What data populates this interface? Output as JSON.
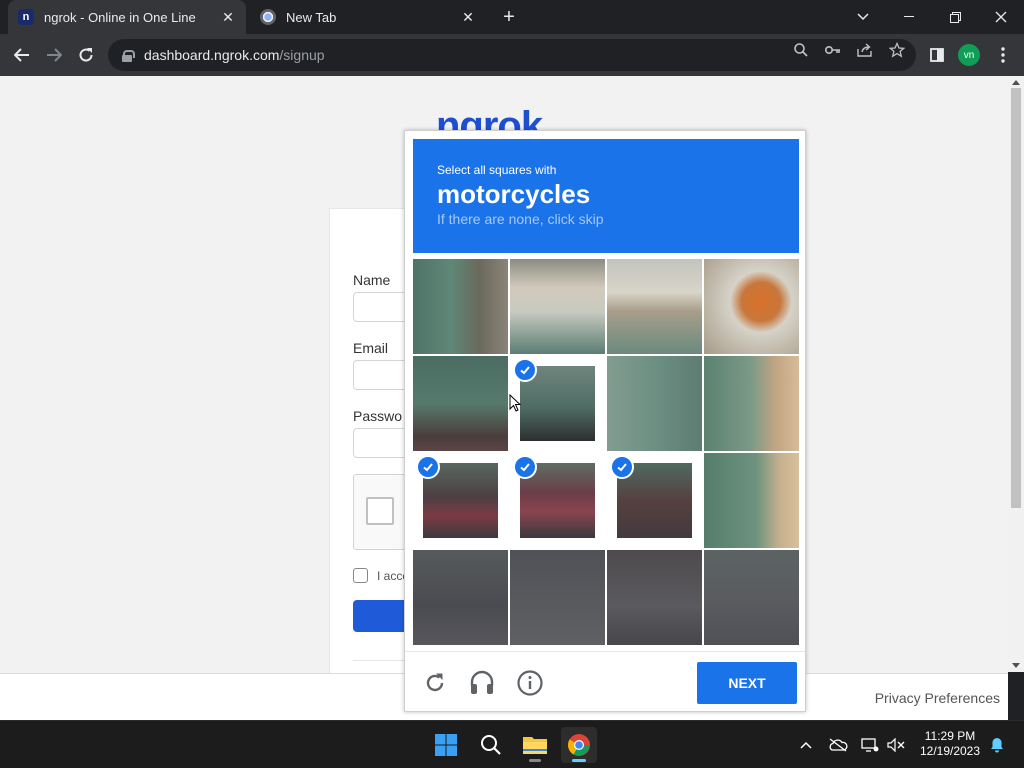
{
  "browser": {
    "tabs": [
      {
        "title": "ngrok - Online in One Line",
        "favicon": "ngrok-favicon",
        "active": true
      },
      {
        "title": "New Tab",
        "favicon": "chrome-favicon",
        "active": false
      }
    ],
    "new_tab_symbol": "+",
    "tab_close_symbol": "✕",
    "url_host": "dashboard.ngrok.com",
    "url_path": "/signup",
    "profile_initials": "vn"
  },
  "page": {
    "logo_text": "ngrok",
    "fields": [
      {
        "label": "Name",
        "value": ""
      },
      {
        "label": "Email",
        "value": ""
      },
      {
        "label": "Passwo",
        "value": ""
      }
    ],
    "agree_label": "I acce",
    "privacy_link": "Privacy Preferences"
  },
  "challenge": {
    "instruction": "Select all squares with",
    "object": "motorcycles",
    "hint": "If there are none, click skip",
    "next_label": "NEXT",
    "selected_tiles": [
      5,
      8,
      9,
      10
    ],
    "footer_icons": [
      "reload-icon",
      "audio-icon",
      "info-icon"
    ],
    "accent_color": "#1a73e8"
  },
  "taskbar": {
    "apps": [
      "start-icon",
      "search-icon",
      "file-explorer-icon",
      "chrome-icon"
    ],
    "active_app": "chrome-icon",
    "time": "11:29 PM",
    "date": "12/19/2023"
  }
}
